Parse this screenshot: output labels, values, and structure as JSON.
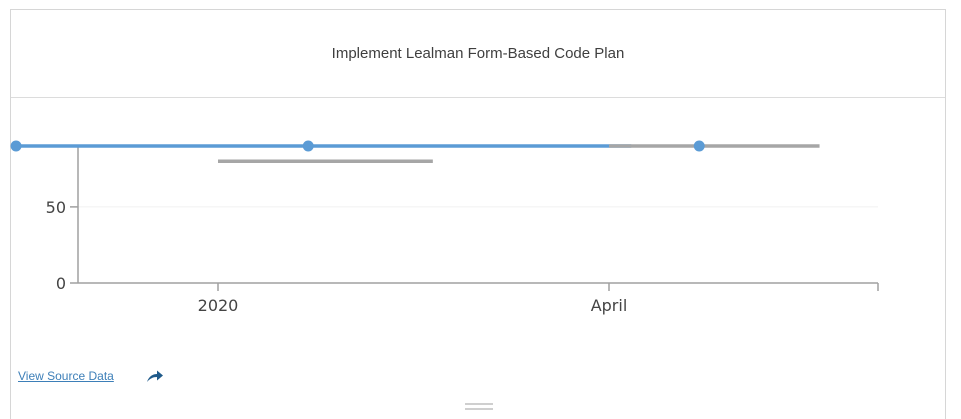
{
  "title": "Implement Lealman Form-Based Code Plan",
  "footer": {
    "link_label": "View Source Data",
    "share_icon": "share-arrow-icon"
  },
  "colors": {
    "series_blue": "#5b9bd5",
    "series_gray": "#a6a6a6",
    "link": "#3d7fb8"
  },
  "chart_data": {
    "type": "line",
    "title": "Implement Lealman Form-Based Code Plan",
    "xlabel": "",
    "ylabel": "",
    "x_tick_labels": [
      "2020",
      "April"
    ],
    "y_tick_labels": [
      "0",
      "50"
    ],
    "y_ticks": [
      0,
      50
    ],
    "ylim": [
      0,
      90
    ],
    "grid": true,
    "series": [
      {
        "color": "#5b9bd5",
        "points": [
          {
            "x": "2019-11-15",
            "y": 90
          },
          {
            "x": "2020-01-22",
            "y": 90
          },
          {
            "x": "2020-04-22",
            "y": 90
          }
        ]
      },
      {
        "color": "#a6a6a6",
        "segments": [
          {
            "x_start": "2020-01-01",
            "x_end": "2020-02-20",
            "y": 80
          },
          {
            "x_start": "2020-04-01",
            "x_end": "2020-05-20",
            "y": 90
          }
        ]
      }
    ]
  }
}
